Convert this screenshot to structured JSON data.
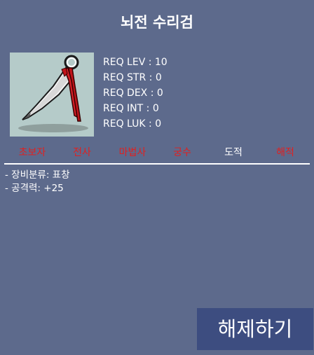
{
  "item": {
    "name": "뇌전 수리검",
    "icon": "throwing-star-icon",
    "requirements": [
      {
        "label": "REQ LEV : 10"
      },
      {
        "label": "REQ STR : 0"
      },
      {
        "label": "REQ DEX : 0"
      },
      {
        "label": "REQ INT : 0"
      },
      {
        "label": "REQ LUK : 0"
      }
    ],
    "jobs": [
      {
        "label": "초보자",
        "color": "#e02020"
      },
      {
        "label": "전사",
        "color": "#e02020"
      },
      {
        "label": "마법사",
        "color": "#e02020"
      },
      {
        "label": "궁수",
        "color": "#e02020"
      },
      {
        "label": "도적",
        "color": "#ffffff"
      },
      {
        "label": "해적",
        "color": "#e02020"
      }
    ],
    "info": [
      "- 장비분류: 표창",
      "- 공격력: +25"
    ]
  },
  "actions": {
    "unequip_label": "해제하기"
  },
  "colors": {
    "panel": "#5d6a8c",
    "button": "#3d4d80",
    "icon_bg": "#b5cbc9",
    "job_unavailable": "#e02020",
    "job_available": "#ffffff"
  }
}
